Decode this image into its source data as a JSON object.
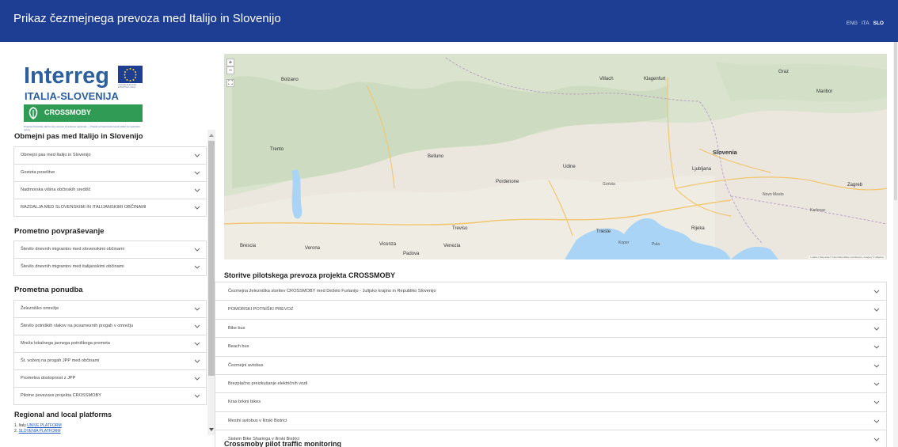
{
  "header": {
    "title": "Prikaz čezmejnega prevoza med Italijo in Slovenijo",
    "languages": [
      {
        "label": "ENG",
        "active": false
      },
      {
        "label": "ITA",
        "active": false
      },
      {
        "label": "SLO",
        "active": true
      }
    ]
  },
  "logo": {
    "wordmark": "Interreg",
    "region": "ITALIA-SLOVENIJA",
    "project": "CROSSMOBY",
    "flag_caption": "UNIONE EUROPEA EVROPSKA UNIJA",
    "fine_print": "Progetto finanziato dal Fondo europeo di sviluppo regionale — Projekt sofinancira Evropski sklad za regionalni razvoj"
  },
  "sidebar": {
    "sections": [
      {
        "title": "Obmejni pas med Italijo in Slovenijo",
        "items": [
          "Obmejni pas med Italijo in Slovenijo",
          "Gostota poselitve",
          "Nadmorska višina občinskih središč",
          "RAZDALJA MED SLOVENSKIMI IN ITALIJANSKIMI OBČINAMI"
        ]
      },
      {
        "title": "Prometno povpraševanje",
        "items": [
          "Število dnevnih migrantov med slovenskimi občinami",
          "Število dnevnih migrantov med italijanskimi občinami"
        ]
      },
      {
        "title": "Prometna ponudba",
        "items": [
          "Železniško omrežje",
          "Število potniških vlakov na posameznih progah v omrežju",
          "Mreža lokalnega javnega potniškega prometa",
          "Št. voženj na progah JPP med občinami",
          "Prometna dostopnost z JPP",
          "Pilotne povezave projekta CROSSMOBY"
        ]
      }
    ],
    "regional": {
      "title": "Regional and local platforms",
      "items": [
        {
          "prefix": "1. Italy",
          "link": "UNIVE PLATFORM"
        },
        {
          "prefix": "2.",
          "link": "SLOVENIA PLATFORM"
        }
      ]
    }
  },
  "map": {
    "zoom_in": "+",
    "zoom_out": "−",
    "fullscreen": "⛶",
    "attribution": "Leaflet | Map data © OpenStreetMap contributors, Imagery © Mapbox",
    "places": {
      "klagenfurt": "Klagenfurt",
      "slovenia": "Slovenia",
      "ljubljana": "Ljubljana",
      "zagreb": "Zagreb",
      "trieste": "Trieste",
      "udine": "Udine",
      "belluno": "Belluno",
      "treviso": "Treviso",
      "vicenza": "Vicenza",
      "pordenone": "Pordenone",
      "gorizia": "Gorizia",
      "venezia": "Venezia",
      "padova": "Padova",
      "maribor": "Maribor",
      "bolzano": "Bolzano",
      "trento": "Trento",
      "verona": "Verona",
      "brescia": "Brescia",
      "rijeka": "Rijeka",
      "villach": "Villach",
      "graz": "Graz",
      "pula": "Pula",
      "koper": "Koper",
      "karlovac": "Karlovac",
      "novo_mesto": "Novo Mesto"
    }
  },
  "services": {
    "title": "Storitve pilotskega prevoza projekta CROSSMOBY",
    "items": [
      "Čezmejna železniška storitev CROSSMOBY med Deželo Furlanijo - Julijsko krajino in Republiko Slovenijo",
      "POMORSKI POTNIŠKI PREVOZ",
      "Bike bus",
      "Beach bus",
      "Čezmejni avtobus",
      "Brezplačno preizkušanje električnih vozil",
      "Kras brkini bikes",
      "Mestni avtobus v Ilirski Bistrici",
      "Sistem Bike Sharinga v Ilirski Bistrici"
    ]
  },
  "monitoring": {
    "title": "Crossmoby pilot traffic monitoring"
  }
}
